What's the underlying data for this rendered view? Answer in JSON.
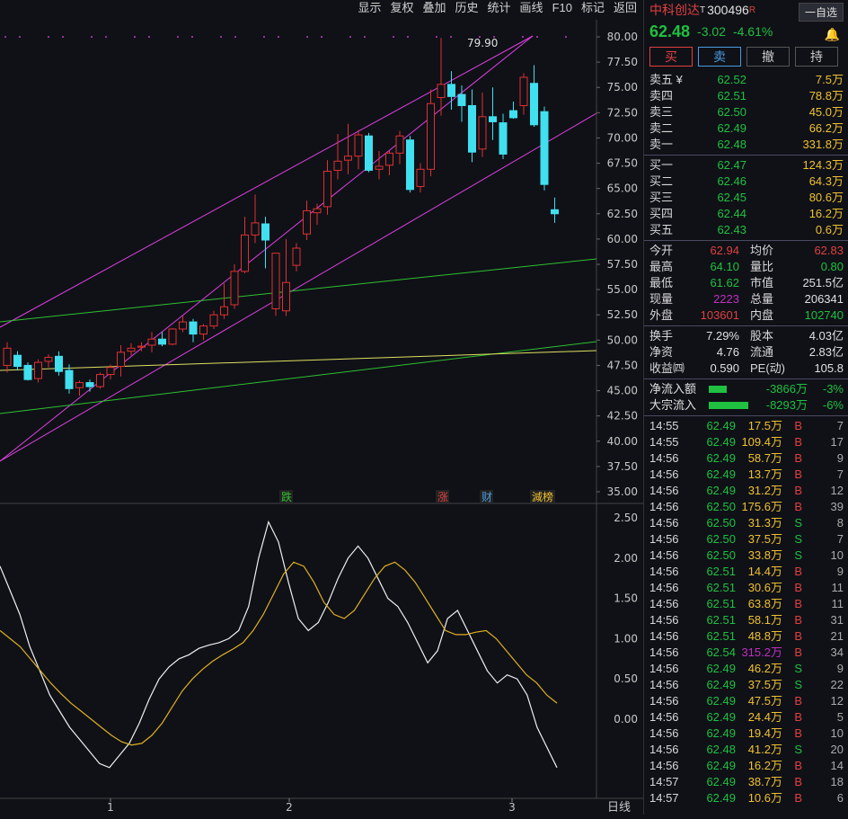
{
  "toolbar": [
    "显示",
    "复权",
    "叠加",
    "历史",
    "统计",
    "画线",
    "F10",
    "标记",
    "返回"
  ],
  "chart_data": {
    "type": "candlestick",
    "y_ticks": [
      "80.00",
      "77.50",
      "75.00",
      "72.50",
      "70.00",
      "67.50",
      "65.00",
      "62.50",
      "60.00",
      "57.50",
      "55.00",
      "52.50",
      "50.00",
      "47.50",
      "45.00",
      "42.50",
      "40.00",
      "37.50",
      "35.00"
    ],
    "high_label": "79.90",
    "events": [
      "跌",
      "涨",
      "财",
      "減榜"
    ],
    "x_labels": [
      "1",
      "2",
      "3"
    ],
    "period": "日线",
    "macd_ticks": [
      "2.50",
      "2.00",
      "1.50",
      "1.00",
      "0.50",
      "0.00"
    ],
    "candles": [
      [
        47.5,
        49.8,
        46.8,
        49.2
      ],
      [
        48.5,
        48.9,
        47.0,
        47.4
      ],
      [
        47.5,
        47.8,
        46.0,
        46.1
      ],
      [
        46.2,
        48.1,
        45.8,
        47.8
      ],
      [
        47.9,
        48.6,
        47.3,
        48.3
      ],
      [
        48.4,
        48.9,
        46.5,
        46.9
      ],
      [
        47.0,
        47.6,
        44.7,
        45.2
      ],
      [
        45.3,
        46.0,
        44.5,
        45.8
      ],
      [
        45.8,
        46.1,
        44.9,
        45.4
      ],
      [
        45.4,
        46.8,
        45.2,
        46.6
      ],
      [
        46.6,
        47.6,
        46.1,
        47.3
      ],
      [
        47.4,
        49.5,
        46.4,
        48.8
      ],
      [
        48.9,
        49.7,
        48.5,
        49.2
      ],
      [
        49.3,
        49.8,
        48.9,
        49.4
      ],
      [
        49.5,
        50.8,
        48.8,
        50.1
      ],
      [
        50.1,
        50.8,
        49.4,
        49.6
      ],
      [
        49.6,
        51.2,
        49.5,
        51.1
      ],
      [
        51.1,
        52.4,
        50.8,
        51.8
      ],
      [
        51.8,
        52.1,
        49.8,
        50.6
      ],
      [
        50.6,
        51.6,
        50.0,
        51.4
      ],
      [
        51.4,
        52.9,
        51.1,
        52.5
      ],
      [
        52.5,
        55.6,
        52.1,
        53.3
      ],
      [
        53.5,
        57.5,
        53.1,
        56.8
      ],
      [
        56.8,
        62.2,
        56.6,
        60.4
      ],
      [
        60.4,
        64.4,
        59.6,
        61.6
      ],
      [
        61.5,
        62.2,
        57.1,
        59.9
      ],
      [
        53.1,
        56.6,
        52.4,
        58.6
      ],
      [
        52.9,
        60.0,
        52.4,
        55.7
      ],
      [
        57.4,
        59.6,
        56.8,
        59.1
      ],
      [
        60.5,
        63.8,
        59.9,
        62.8
      ],
      [
        62.6,
        63.5,
        61.4,
        63.0
      ],
      [
        63.2,
        67.8,
        62.4,
        66.7
      ],
      [
        66.8,
        70.4,
        65.9,
        67.7
      ],
      [
        67.8,
        71.4,
        66.4,
        68.2
      ],
      [
        68.2,
        70.8,
        66.9,
        70.3
      ],
      [
        70.2,
        70.5,
        66.6,
        66.8
      ],
      [
        66.9,
        68.7,
        65.9,
        67.2
      ],
      [
        67.3,
        68.7,
        66.3,
        68.5
      ],
      [
        68.5,
        70.7,
        67.4,
        70.2
      ],
      [
        69.8,
        70.2,
        64.6,
        64.9
      ],
      [
        65.2,
        67.5,
        64.6,
        66.9
      ],
      [
        66.9,
        74.8,
        66.2,
        73.4
      ],
      [
        74.0,
        79.9,
        72.2,
        75.3
      ],
      [
        75.3,
        76.6,
        72.8,
        74.1
      ],
      [
        74.3,
        75.2,
        71.6,
        73.2
      ],
      [
        73.2,
        74.8,
        67.6,
        68.6
      ],
      [
        68.9,
        74.5,
        68.1,
        72.1
      ],
      [
        72.1,
        75.0,
        69.8,
        71.6
      ],
      [
        71.5,
        72.4,
        67.9,
        68.4
      ],
      [
        72.7,
        73.6,
        71.9,
        72.0
      ],
      [
        73.2,
        76.4,
        72.3,
        76.0
      ],
      [
        75.4,
        77.2,
        71.1,
        71.3
      ],
      [
        72.6,
        73.1,
        64.8,
        65.4
      ],
      [
        62.9,
        64.1,
        61.6,
        62.5
      ]
    ],
    "dif": [
      1.9,
      1.6,
      1.3,
      0.9,
      0.6,
      0.3,
      0.1,
      -0.1,
      -0.25,
      -0.4,
      -0.55,
      -0.6,
      -0.45,
      -0.3,
      -0.05,
      0.25,
      0.5,
      0.65,
      0.75,
      0.8,
      0.88,
      0.92,
      0.95,
      1.0,
      1.1,
      1.4,
      2.0,
      2.45,
      2.2,
      1.7,
      1.25,
      1.1,
      1.2,
      1.45,
      1.75,
      2.0,
      2.15,
      2.0,
      1.75,
      1.5,
      1.4,
      1.2,
      0.95,
      0.7,
      0.85,
      1.25,
      1.35,
      1.1,
      0.85,
      0.6,
      0.45,
      0.55,
      0.5,
      0.3,
      -0.1,
      -0.35,
      -0.6
    ],
    "dea": [
      1.1,
      1.0,
      0.9,
      0.75,
      0.6,
      0.45,
      0.32,
      0.2,
      0.1,
      0.0,
      -0.1,
      -0.2,
      -0.28,
      -0.32,
      -0.3,
      -0.2,
      -0.05,
      0.15,
      0.35,
      0.5,
      0.62,
      0.72,
      0.8,
      0.87,
      0.95,
      1.1,
      1.3,
      1.55,
      1.8,
      1.95,
      1.9,
      1.7,
      1.45,
      1.3,
      1.25,
      1.35,
      1.55,
      1.75,
      1.9,
      1.95,
      1.85,
      1.7,
      1.5,
      1.3,
      1.1,
      1.05,
      1.05,
      1.08,
      1.1,
      1.0,
      0.85,
      0.7,
      0.55,
      0.45,
      0.3,
      0.2
    ]
  },
  "panel": {
    "name": "中科创达",
    "tag": "T",
    "code": "300496",
    "rflag": "R",
    "add_btn": "一自选",
    "price": "62.48",
    "change": "-3.02",
    "pct": "-4.61%",
    "bell_icon": "bell-icon",
    "actions": [
      "买",
      "卖",
      "撤",
      "持"
    ],
    "asks": [
      [
        "卖五 ¥",
        "62.52",
        "7.5万"
      ],
      [
        "卖四",
        "62.51",
        "78.8万"
      ],
      [
        "卖三",
        "62.50",
        "45.0万"
      ],
      [
        "卖二",
        "62.49",
        "66.2万"
      ],
      [
        "卖一",
        "62.48",
        "331.8万"
      ]
    ],
    "bids": [
      [
        "买一",
        "62.47",
        "124.3万"
      ],
      [
        "买二",
        "62.46",
        "64.3万"
      ],
      [
        "买三",
        "62.45",
        "80.6万"
      ],
      [
        "买四",
        "62.44",
        "16.2万"
      ],
      [
        "买五",
        "62.43",
        "0.6万"
      ]
    ],
    "stats": [
      [
        "今开",
        "62.94",
        "#e04040",
        "均价",
        "62.83",
        "#e04040"
      ],
      [
        "最高",
        "64.10",
        "#20c040",
        "量比",
        "0.80",
        "#20c040"
      ],
      [
        "最低",
        "61.62",
        "#20c040",
        "市值",
        "251.5亿",
        "#e0e0e0"
      ],
      [
        "现量",
        "2223",
        "#c030c0",
        "总量",
        "206341",
        "#e0e0e0"
      ],
      [
        "外盘",
        "103601",
        "#e04040",
        "内盘",
        "102740",
        "#20c040"
      ]
    ],
    "stats2": [
      [
        "换手",
        "7.29%",
        "股本",
        "4.03亿"
      ],
      [
        "净资",
        "4.76",
        "流通",
        "2.83亿"
      ],
      [
        "收益㈣",
        "0.590",
        "PE(动)",
        "105.8"
      ]
    ],
    "flows": [
      [
        "净流入额",
        "-3866万",
        "-3%",
        18
      ],
      [
        "大宗流入",
        "-8293万",
        "-6%",
        40
      ]
    ],
    "ticks": [
      [
        "14:55",
        "62.49",
        "17.5万",
        "B",
        "7"
      ],
      [
        "14:55",
        "62.49",
        "109.4万",
        "B",
        "17"
      ],
      [
        "14:56",
        "62.49",
        "58.7万",
        "B",
        "9"
      ],
      [
        "14:56",
        "62.49",
        "13.7万",
        "B",
        "7"
      ],
      [
        "14:56",
        "62.49",
        "31.2万",
        "B",
        "12"
      ],
      [
        "14:56",
        "62.50",
        "175.6万",
        "B",
        "39"
      ],
      [
        "14:56",
        "62.50",
        "31.3万",
        "S",
        "8"
      ],
      [
        "14:56",
        "62.50",
        "37.5万",
        "S",
        "7"
      ],
      [
        "14:56",
        "62.50",
        "33.8万",
        "S",
        "10"
      ],
      [
        "14:56",
        "62.51",
        "14.4万",
        "B",
        "9"
      ],
      [
        "14:56",
        "62.51",
        "30.6万",
        "B",
        "11"
      ],
      [
        "14:56",
        "62.51",
        "63.8万",
        "B",
        "11"
      ],
      [
        "14:56",
        "62.51",
        "58.1万",
        "B",
        "31"
      ],
      [
        "14:56",
        "62.51",
        "48.8万",
        "B",
        "21"
      ],
      [
        "14:56",
        "62.54",
        "315.2万",
        "B",
        "34"
      ],
      [
        "14:56",
        "62.49",
        "46.2万",
        "S",
        "9"
      ],
      [
        "14:56",
        "62.49",
        "37.5万",
        "S",
        "22"
      ],
      [
        "14:56",
        "62.49",
        "47.5万",
        "B",
        "12"
      ],
      [
        "14:56",
        "62.49",
        "24.4万",
        "B",
        "5"
      ],
      [
        "14:56",
        "62.49",
        "19.4万",
        "B",
        "10"
      ],
      [
        "14:56",
        "62.48",
        "41.2万",
        "S",
        "20"
      ],
      [
        "14:56",
        "62.49",
        "16.2万",
        "B",
        "14"
      ],
      [
        "14:57",
        "62.49",
        "38.7万",
        "B",
        "18"
      ],
      [
        "14:57",
        "62.49",
        "10.6万",
        "B",
        "6"
      ]
    ]
  }
}
